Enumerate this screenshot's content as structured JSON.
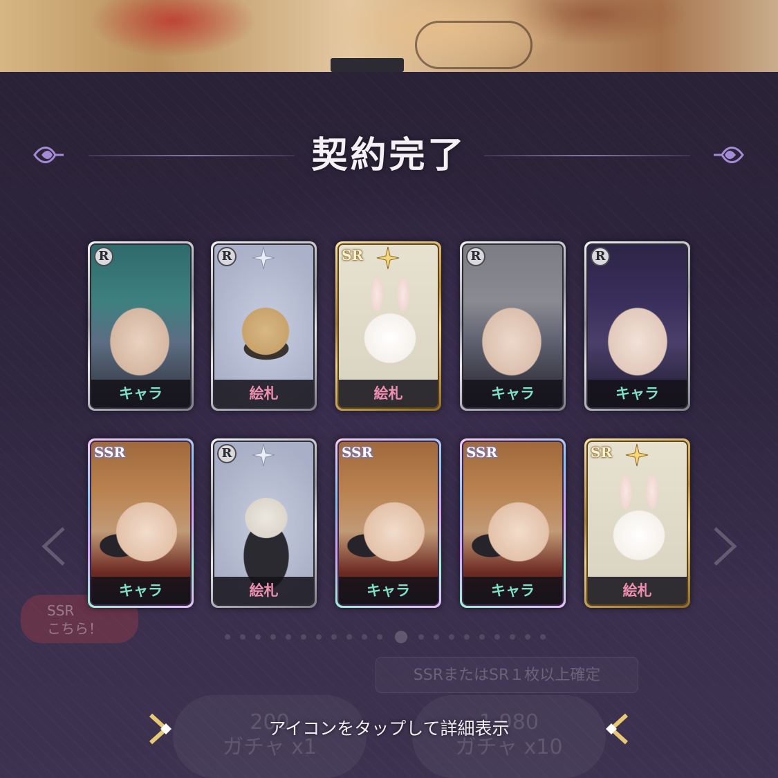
{
  "screen": {
    "title": "契約完了",
    "hint": "アイコンをタップして詳細表示"
  },
  "background_ui": {
    "guarantee_badge": "SSRまたはSR１枚以上確定",
    "single_pull": {
      "cost": "200",
      "label": "ガチャ x1"
    },
    "ten_pull": {
      "cost": "1,980",
      "label": "ガチャ x10"
    },
    "speech_bubble": [
      "SSR",
      "こちら！"
    ]
  },
  "cards": [
    {
      "rarity": "R",
      "type": "キャラ",
      "subject": "teal-haired man"
    },
    {
      "rarity": "R",
      "type": "絵札",
      "subject": "tanuki"
    },
    {
      "rarity": "SR",
      "type": "絵札",
      "subject": "white bunny"
    },
    {
      "rarity": "R",
      "type": "キャラ",
      "subject": "gray-haired man"
    },
    {
      "rarity": "R",
      "type": "キャラ",
      "subject": "dark-haired man"
    },
    {
      "rarity": "SSR",
      "type": "キャラ",
      "subject": "brown-haired man with glasses"
    },
    {
      "rarity": "R",
      "type": "絵札",
      "subject": "skull cat"
    },
    {
      "rarity": "SSR",
      "type": "キャラ",
      "subject": "brown-haired man with glasses"
    },
    {
      "rarity": "SSR",
      "type": "キャラ",
      "subject": "brown-haired man with glasses"
    },
    {
      "rarity": "SR",
      "type": "絵札",
      "subject": "white bunny"
    }
  ],
  "colors": {
    "chara_label": "#7fe0c6",
    "efuda_label": "#ef8fb0",
    "panel_bg": "#2f2640"
  }
}
